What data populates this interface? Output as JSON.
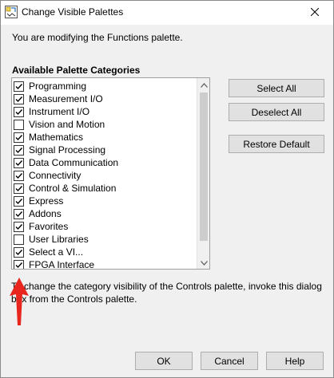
{
  "window": {
    "title": "Change Visible Palettes",
    "close_icon": "close-icon",
    "app_icon": "labview-vi-icon"
  },
  "intro_text": "You are modifying the Functions palette.",
  "categories_label": "Available Palette Categories",
  "categories": [
    {
      "label": "Programming",
      "checked": true
    },
    {
      "label": "Measurement I/O",
      "checked": true
    },
    {
      "label": "Instrument I/O",
      "checked": true
    },
    {
      "label": "Vision and Motion",
      "checked": false
    },
    {
      "label": "Mathematics",
      "checked": true
    },
    {
      "label": "Signal Processing",
      "checked": true
    },
    {
      "label": "Data Communication",
      "checked": true
    },
    {
      "label": "Connectivity",
      "checked": true
    },
    {
      "label": "Control & Simulation",
      "checked": true
    },
    {
      "label": "Express",
      "checked": true
    },
    {
      "label": "Addons",
      "checked": true
    },
    {
      "label": "Favorites",
      "checked": true
    },
    {
      "label": "User Libraries",
      "checked": false
    },
    {
      "label": "Select a VI...",
      "checked": true
    },
    {
      "label": "FPGA Interface",
      "checked": true
    }
  ],
  "buttons": {
    "select_all": "Select All",
    "deselect_all": "Deselect All",
    "restore_default": "Restore Default",
    "ok": "OK",
    "cancel": "Cancel",
    "help": "Help"
  },
  "help_text": "To change the category visibility of the Controls palette, invoke this dialog box from the Controls palette.",
  "colors": {
    "arrow": "#e8261e",
    "dialog_bg": "#f0f0f0",
    "button_bg": "#e1e1e1"
  }
}
